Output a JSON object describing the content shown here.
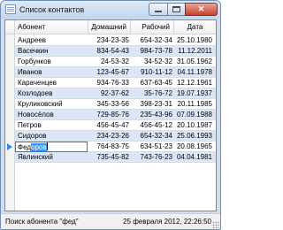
{
  "window": {
    "title": "Список контактов",
    "minimize_glyph": "minimize",
    "maximize_glyph": "maximize",
    "close_glyph": "✕"
  },
  "table": {
    "columns": [
      "Абонент",
      "Домашний",
      "Рабочий",
      "Дата"
    ],
    "rows": [
      {
        "name": "Андреев",
        "home": "234-23-35",
        "work": "654-32-34",
        "date": "25.10.1980"
      },
      {
        "name": "Васечкин",
        "home": "834-54-43",
        "work": "984-73-78",
        "date": "11.12.2011"
      },
      {
        "name": "Горбунков",
        "home": "24-53-32",
        "work": "34-52-32",
        "date": "31.05.1962"
      },
      {
        "name": "Иванов",
        "home": "123-45-67",
        "work": "910-11-12",
        "date": "04.11.1978"
      },
      {
        "name": "Караченцев",
        "home": "934-76-33",
        "work": "637-63-45",
        "date": "12.12.1961"
      },
      {
        "name": "Козлодоев",
        "home": "92-37-62",
        "work": "35-76-72",
        "date": "19.07.1937"
      },
      {
        "name": "Круликовский",
        "home": "345-33-56",
        "work": "398-23-31",
        "date": "20.11.1985"
      },
      {
        "name": "Новосёлов",
        "home": "729-85-76",
        "work": "235-43-96",
        "date": "07.09.1988"
      },
      {
        "name": "Петров",
        "home": "456-45-47",
        "work": "456-45-12",
        "date": "20.10.1987"
      },
      {
        "name": "Сидоров",
        "home": "234-23-26",
        "work": "654-32-34",
        "date": "25.06.1993"
      },
      {
        "name": "Федоров",
        "home": "764-83-75",
        "work": "634-51-23",
        "date": "20.08.1965"
      },
      {
        "name": "Явлинский",
        "home": "735-45-82",
        "work": "743-76-23",
        "date": "04.04.1981"
      }
    ],
    "current_row_index": 10,
    "editing": {
      "typed_prefix": "Фед",
      "selected_rest": "оров"
    }
  },
  "statusbar": {
    "search_text": "Поиск абонента  \"фед\"",
    "datetime": "25 февраля 2012, 22:26:50"
  },
  "colors": {
    "alt_row": "#dbe7f6",
    "selection": "#3399ff",
    "current_marker": "#2e8ae6"
  }
}
